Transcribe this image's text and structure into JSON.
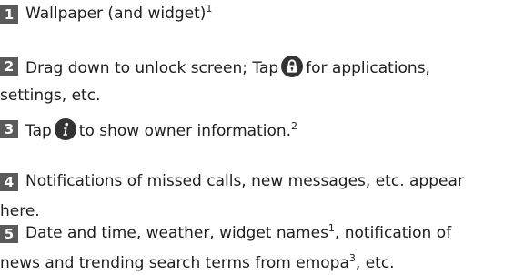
{
  "items": [
    {
      "number": "1",
      "text_a": "Wallpaper (and widget)",
      "sup_a": "1"
    },
    {
      "number": "2",
      "line1_a": "Drag down to unlock screen; Tap",
      "icon": "lock-icon",
      "line1_b": "for applications,",
      "line2": "settings, etc."
    },
    {
      "number": "3",
      "text_a": "Tap",
      "icon": "info-icon",
      "text_b": "to show owner information.",
      "sup_a": "2"
    },
    {
      "number": "4",
      "line1": "Notifications of missed calls, new messages, etc. appear",
      "line2": "here."
    },
    {
      "number": "5",
      "line1_a": "Date and time, weather, widget names",
      "sup_a": "1",
      "line1_b": ", notification of",
      "line2_a": "news and trending search terms from emopa",
      "sup_b": "3",
      "line2_b": ", etc."
    }
  ],
  "colors": {
    "badge": "#5a5a5a",
    "icon": "#333333",
    "text": "#1e1e1e"
  }
}
